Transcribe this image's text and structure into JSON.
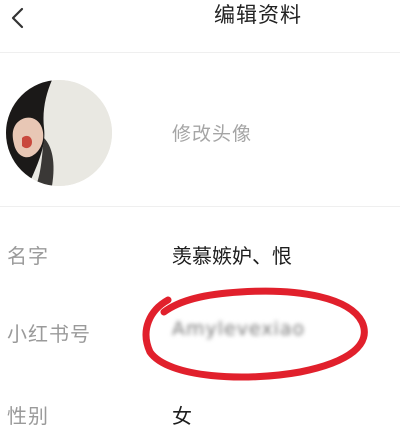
{
  "header": {
    "title": "编辑资料",
    "back_icon": "chevron-left-icon"
  },
  "profile": {
    "change_avatar_label": "修改头像",
    "fields": [
      {
        "label": "名字",
        "value": "羡慕嫉妒、恨"
      },
      {
        "label": "小红书号",
        "value": "Amylevexiao"
      },
      {
        "label": "性别",
        "value": "女"
      }
    ]
  },
  "colors": {
    "annotation_red": "#e1202c",
    "label_gray": "#9a9a9a"
  }
}
